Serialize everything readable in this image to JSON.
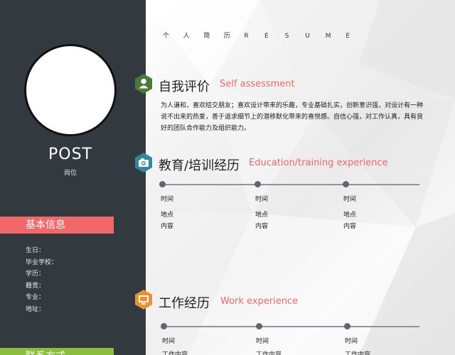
{
  "colors": {
    "sidebar": "#323a40",
    "accent_red": "#f26868",
    "accent_green": "#8bbd3c",
    "icon_green": "#4a7a3a",
    "icon_teal": "#2d8a9c",
    "icon_orange": "#f0902a"
  },
  "sidebar": {
    "post_title": "POST",
    "post_subtitle": "岗位",
    "basic_info_label": "基本信息",
    "info_fields": [
      "生日：",
      "毕业学校：",
      "学历：",
      "籍贯：",
      "专业：",
      "地址："
    ],
    "contact_label": "联系方式"
  },
  "header": {
    "letters": [
      "个",
      "人",
      "简",
      "历",
      "R",
      "E",
      "S",
      "U",
      "M",
      "E"
    ]
  },
  "sections": {
    "self": {
      "icon": "user-icon",
      "title": "自我评价",
      "title_en": "Self assessment",
      "paragraph": "为人谦和，喜欢结交朋友；喜欢设计带来的乐趣，专业基础扎实，创新意识强，对设计有一种说不出来的热爱，善于追求细节上的潜移默化带来的喜悦感。自信心强，对工作认真，具有良好的团队合作能力及组织能力。"
    },
    "education": {
      "icon": "camera-icon",
      "title": "教育/培训经历",
      "title_en": "Education/training experience",
      "entries": [
        {
          "time": "时间",
          "place": "地点",
          "content": "内容"
        },
        {
          "time": "时间",
          "place": "地点",
          "content": "内容"
        },
        {
          "time": "时间",
          "place": "地点",
          "content": "内容"
        }
      ]
    },
    "work": {
      "icon": "monitor-icon",
      "title": "工作经历",
      "title_en": "Work experience",
      "entries": [
        {
          "time": "时间",
          "content": "工作内容"
        },
        {
          "time": "时间",
          "content": "工作内容"
        },
        {
          "time": "时间",
          "content": "工作内容"
        }
      ]
    }
  }
}
